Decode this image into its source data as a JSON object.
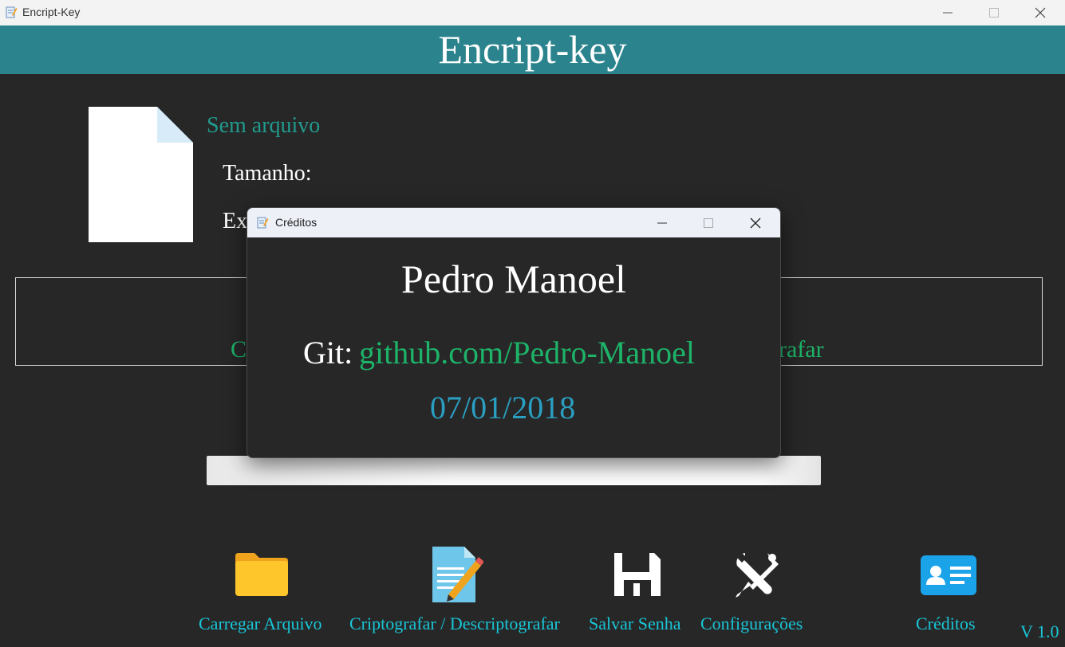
{
  "window": {
    "title": "Encript-Key"
  },
  "banner": {
    "title": "Encript-key"
  },
  "file_info": {
    "name": "Sem arquivo",
    "size_label": "Tamanho:",
    "ext_label": "Ex"
  },
  "drop_area": {
    "text_left": "C",
    "text_right": "rafar"
  },
  "toolbar": {
    "load_label": "Carregar Arquivo",
    "encrypt_label": "Criptografar / Descriptografar",
    "save_label": "Salvar Senha",
    "settings_label": "Configurações",
    "credits_label": "Créditos"
  },
  "version": "V 1.0",
  "credits_dialog": {
    "title": "Créditos",
    "author": "Pedro Manoel",
    "git_label": "Git:",
    "git_url": "github.com/Pedro-Manoel",
    "date": "07/01/2018"
  },
  "colors": {
    "banner": "#2b838d",
    "accent_cyan": "#19c6d8",
    "link_green": "#1db368",
    "file_name_teal": "#219a8c",
    "date_blue": "#2a9fc2",
    "background": "#272727"
  }
}
